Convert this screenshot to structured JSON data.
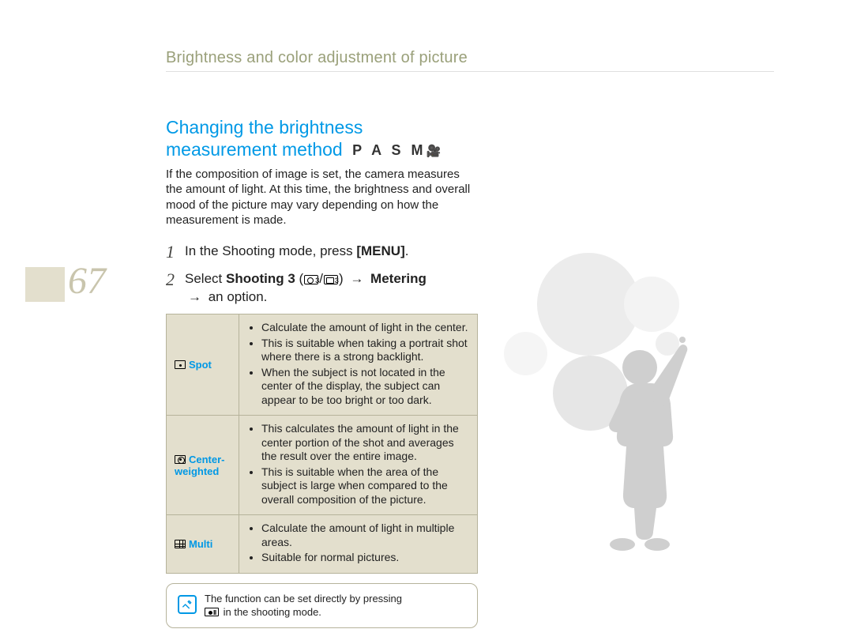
{
  "header": {
    "title": "Brightness and color adjustment of picture"
  },
  "page_number": "67",
  "section": {
    "title_line1": "Changing the brightness",
    "title_line2": "measurement method",
    "modes": "P A S M",
    "intro": "If the composition of image is set, the camera measures the amount of light. At this time, the brightness and overall mood of the picture may vary depending on how the measurement is made."
  },
  "steps": [
    {
      "num": "1",
      "prefix": "In the Shooting mode, press ",
      "bold1": "[MENU]",
      "suffix": "."
    },
    {
      "num": "2",
      "prefix": "Select ",
      "bold1": "Shooting 3",
      "mid": " (",
      "icons": true,
      "mid2": ") ",
      "arrow1": "→",
      "bold2": " Metering",
      "line2_arrow": "→",
      "line2_text": " an option."
    }
  ],
  "table": {
    "rows": [
      {
        "label": "Spot",
        "icon": "spot",
        "bullets": [
          "Calculate the amount of light in the center.",
          "This is suitable when taking a portrait shot where there is a strong backlight.",
          "When the subject is not located in the center of the display, the subject can appear to be too bright or too dark."
        ]
      },
      {
        "label": "Center-weighted",
        "icon": "center",
        "bullets": [
          "This calculates the amount of light in the center portion of the shot and averages the result over the entire image.",
          "This is suitable when the area of the subject is large when compared to the overall composition of the picture."
        ]
      },
      {
        "label": "Multi",
        "icon": "multi",
        "bullets": [
          "Calculate the amount of light in multiple areas.",
          "Suitable for normal pictures."
        ]
      }
    ]
  },
  "note": {
    "line1": "The function can be set directly by pressing",
    "line2_suffix": " in the shooting mode."
  }
}
